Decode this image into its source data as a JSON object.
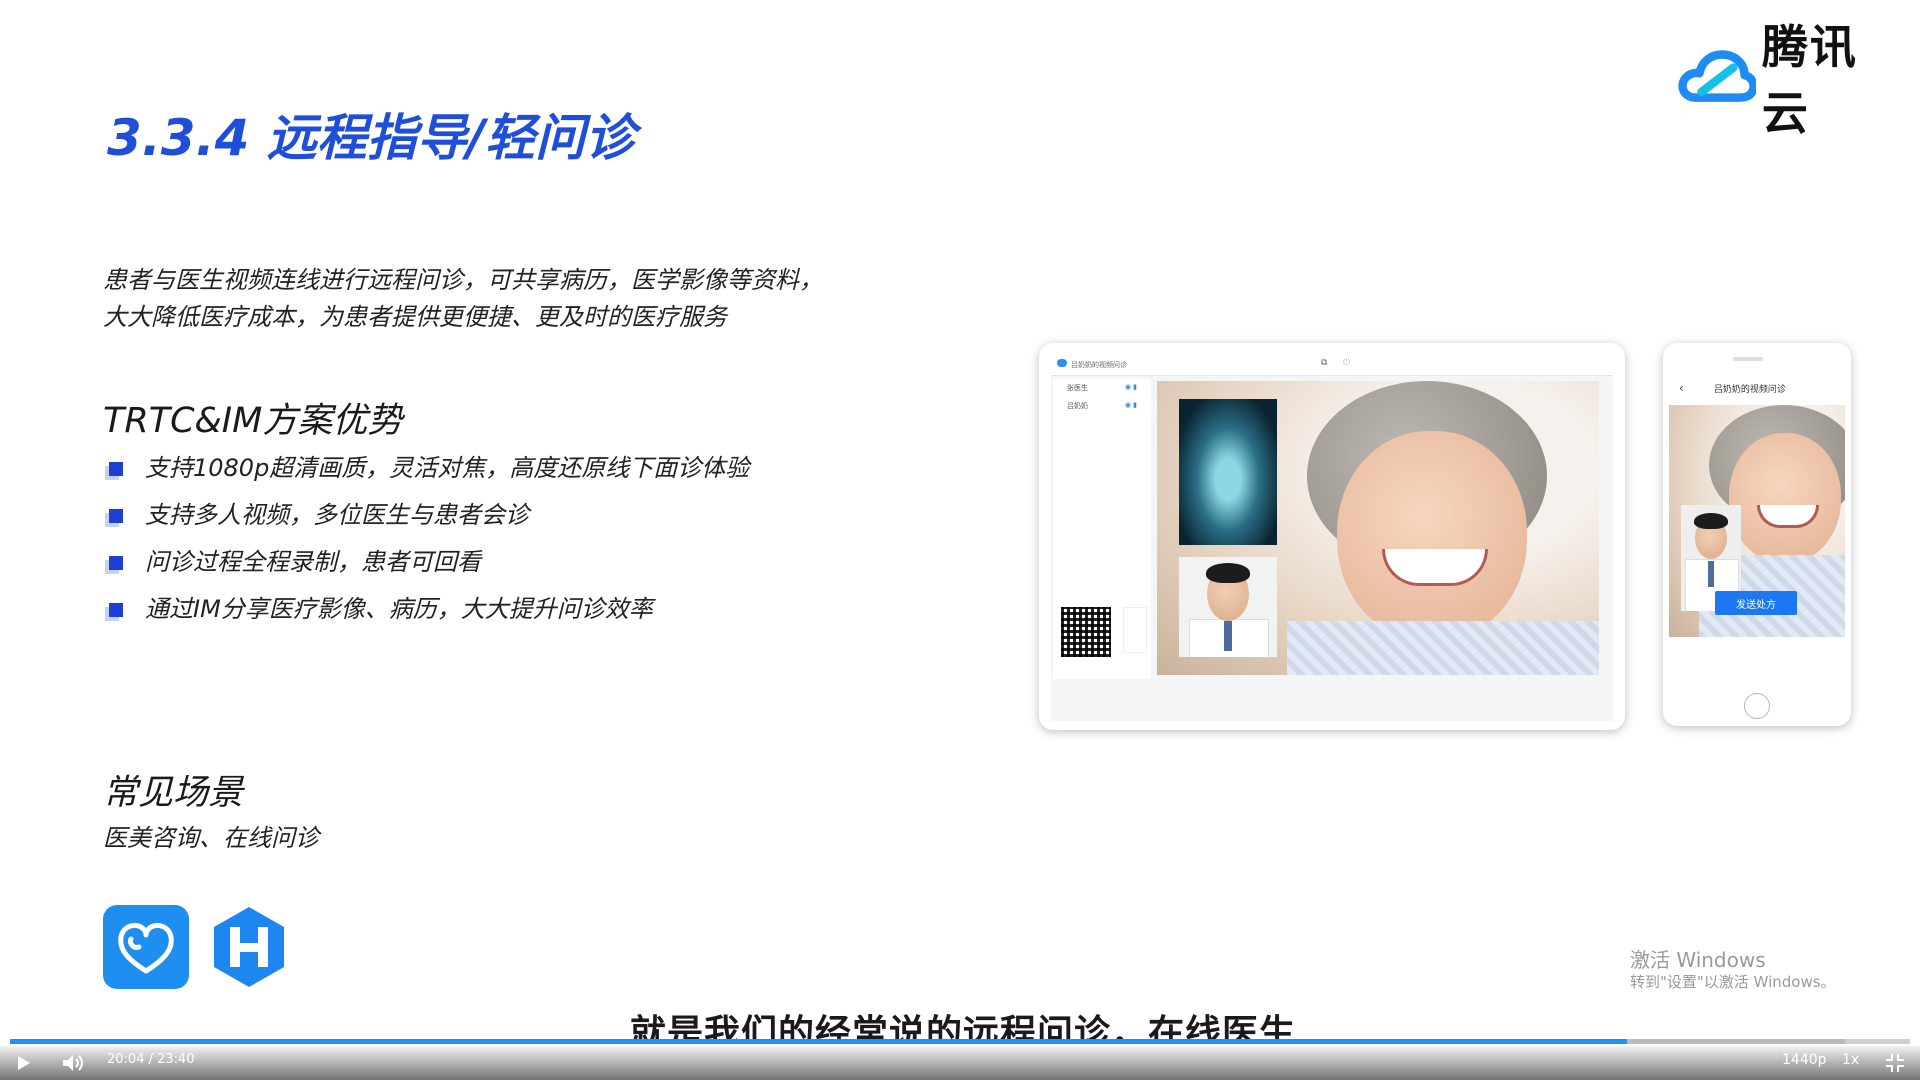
{
  "brand": {
    "name": "腾讯云",
    "color": "#1f8cf5"
  },
  "slide": {
    "title": "3.3.4 远程指导/轻问诊",
    "description_lines": [
      "患者与医生视频连线进行远程问诊，可共享病历，医学影像等资料，",
      "大大降低医疗成本，为患者提供更便捷、更及时的医疗服务"
    ],
    "advantages_heading": "TRTC&IM方案优势",
    "advantages": [
      "支持1080p超清画质，灵活对焦，高度还原线下面诊体验",
      "支持多人视频，多位医生与患者会诊",
      "问诊过程全程录制，患者可回看",
      "通过IM分享医疗影像、病历，大大提升问诊效率"
    ],
    "scenes_heading": "常见场景",
    "scenes_text": "医美咨询、在线问诊",
    "accent_color": "#1f4fd8"
  },
  "tablet": {
    "window_title": "吕奶奶的视频问诊",
    "participants": [
      "张医生",
      "吕奶奶"
    ]
  },
  "phone": {
    "nav_title": "吕奶奶的视频问诊",
    "action_button": "发送处方"
  },
  "watermark": {
    "line1": "激活 Windows",
    "line2": "转到\"设置\"以激活 Windows。"
  },
  "player": {
    "subtitle": "就是我们的经常说的远程问诊，在线医生",
    "time": "20:04 / 23:40",
    "quality": "1440p",
    "speed": "1x",
    "progress_fraction": 0.857
  }
}
